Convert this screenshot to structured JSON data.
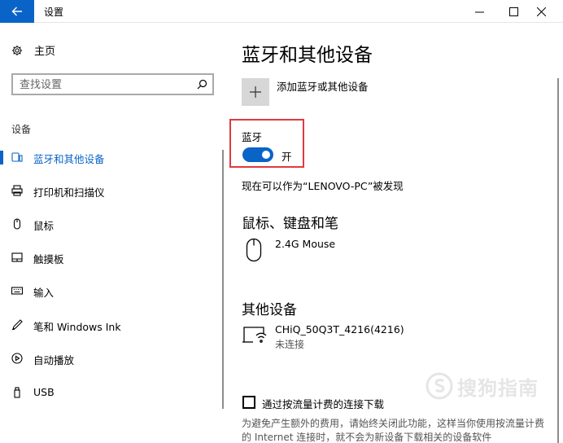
{
  "window": {
    "title": "设置"
  },
  "sidebar": {
    "home_label": "主页",
    "search_placeholder": "查找设置",
    "section_label": "设备",
    "items": [
      {
        "label": "蓝牙和其他设备",
        "icon": "bluetooth-devices-icon",
        "active": true
      },
      {
        "label": "打印机和扫描仪",
        "icon": "printer-icon"
      },
      {
        "label": "鼠标",
        "icon": "mouse-icon"
      },
      {
        "label": "触摸板",
        "icon": "touchpad-icon"
      },
      {
        "label": "输入",
        "icon": "keyboard-icon"
      },
      {
        "label": "笔和 Windows Ink",
        "icon": "pen-icon"
      },
      {
        "label": "自动播放",
        "icon": "autoplay-icon"
      },
      {
        "label": "USB",
        "icon": "usb-icon"
      }
    ]
  },
  "main": {
    "title": "蓝牙和其他设备",
    "add_device_label": "添加蓝牙或其他设备",
    "bluetooth": {
      "label": "蓝牙",
      "state": "开",
      "on": true
    },
    "discoverable_text": "现在可以作为“LENOVO-PC”被发现",
    "mouse_section": {
      "title": "鼠标、键盘和笔",
      "devices": [
        {
          "name": "2.4G Mouse"
        }
      ]
    },
    "other_section": {
      "title": "其他设备",
      "devices": [
        {
          "name": "CHiQ_50Q3T_4216(4216)",
          "status": "未连接"
        }
      ]
    },
    "metered": {
      "label": "通过按流量计费的连接下载",
      "checked": false,
      "description": "为避免产生额外的费用，请始终关闭此功能，这样当你使用按流量计费的 Internet 连接时，就不会为新设备下载相关的设备软件"
    }
  },
  "watermark": {
    "text": "搜狗指南"
  },
  "colors": {
    "accent": "#0a64c8",
    "highlight": "#e0393e"
  }
}
